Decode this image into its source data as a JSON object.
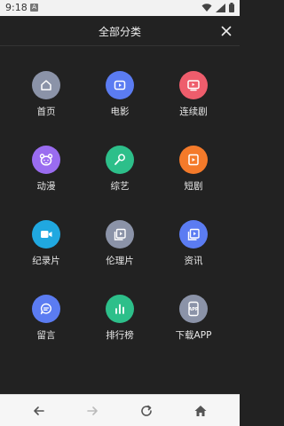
{
  "status": {
    "time": "9:18",
    "notif_letter": "A"
  },
  "header": {
    "title": "全部分类"
  },
  "categories": [
    {
      "label": "首页",
      "icon": "home-icon",
      "color": "#8b93a8"
    },
    {
      "label": "电影",
      "icon": "movie-icon",
      "color": "#5b7cf2"
    },
    {
      "label": "连续剧",
      "icon": "tv-icon",
      "color": "#ee5d6c"
    },
    {
      "label": "动漫",
      "icon": "bear-icon",
      "color": "#9a6cf0"
    },
    {
      "label": "综艺",
      "icon": "microphone-icon",
      "color": "#2dbf8a"
    },
    {
      "label": "短剧",
      "icon": "short-video-icon",
      "color": "#f47a2a"
    },
    {
      "label": "纪录片",
      "icon": "camera-icon",
      "color": "#20a8e0"
    },
    {
      "label": "伦理片",
      "icon": "video-library-icon",
      "color": "#8b93a8"
    },
    {
      "label": "资讯",
      "icon": "news-video-icon",
      "color": "#5b7cf2"
    },
    {
      "label": "留言",
      "icon": "message-icon",
      "color": "#5b7cf2"
    },
    {
      "label": "排行榜",
      "icon": "chart-icon",
      "color": "#2dbf8a"
    },
    {
      "label": "下载APP",
      "icon": "app-download-icon",
      "color": "#8b93a8"
    }
  ]
}
